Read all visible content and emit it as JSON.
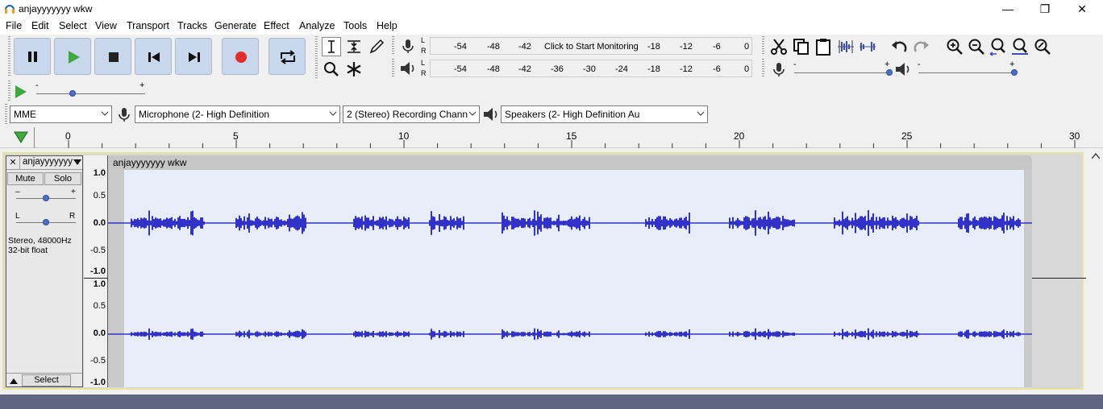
{
  "window": {
    "title": "anjayyyyyyy wkw",
    "minimize": "—",
    "maximize": "❐",
    "close": "✕"
  },
  "menu": [
    "File",
    "Edit",
    "Select",
    "View",
    "Transport",
    "Tracks",
    "Generate",
    "Effect",
    "Analyze",
    "Tools",
    "Help"
  ],
  "meters": {
    "record_scale": [
      "-54",
      "-48",
      "-42",
      "Click to Start Monitoring",
      "-18",
      "-12",
      "-6",
      "0"
    ],
    "play_scale": [
      "-54",
      "-48",
      "-42",
      "-36",
      "-30",
      "-24",
      "-18",
      "-12",
      "-6",
      "0"
    ],
    "left": "L",
    "right": "R"
  },
  "device": {
    "host": "MME",
    "input": "Microphone (2- High Definition",
    "channels": "2 (Stereo) Recording Chann",
    "output": "Speakers (2- High Definition Au"
  },
  "ruler": {
    "ticks": [
      "0",
      "5",
      "10",
      "15",
      "20",
      "25",
      "30"
    ]
  },
  "track": {
    "name": "anjayyyyyyy",
    "clip_name": "anjayyyyyyy wkw",
    "mute": "Mute",
    "solo": "Solo",
    "gain_minus": "–",
    "gain_plus": "+",
    "pan_left": "L",
    "pan_right": "R",
    "info_line1": "Stereo, 48000Hz",
    "info_line2": "32-bit float",
    "select": "Select",
    "close": "✕",
    "scale": [
      "1.0",
      "0.5",
      "0.0",
      "-0.5",
      "-1.0"
    ],
    "gain_level": 0.5,
    "pan_level": 0.5
  },
  "play_at_speed": {
    "minus": "-",
    "plus": "+",
    "level": 0.33
  },
  "mixer": {
    "rec_minus": "-",
    "rec_plus": "+",
    "rec_level": 1.0,
    "play_minus": "-",
    "play_plus": "+",
    "play_level": 1.0
  },
  "colors": {
    "waveform": "#3232c8",
    "wave_bg": "#e7eefa",
    "record": "#e22d2d",
    "play": "#3fa83f"
  }
}
